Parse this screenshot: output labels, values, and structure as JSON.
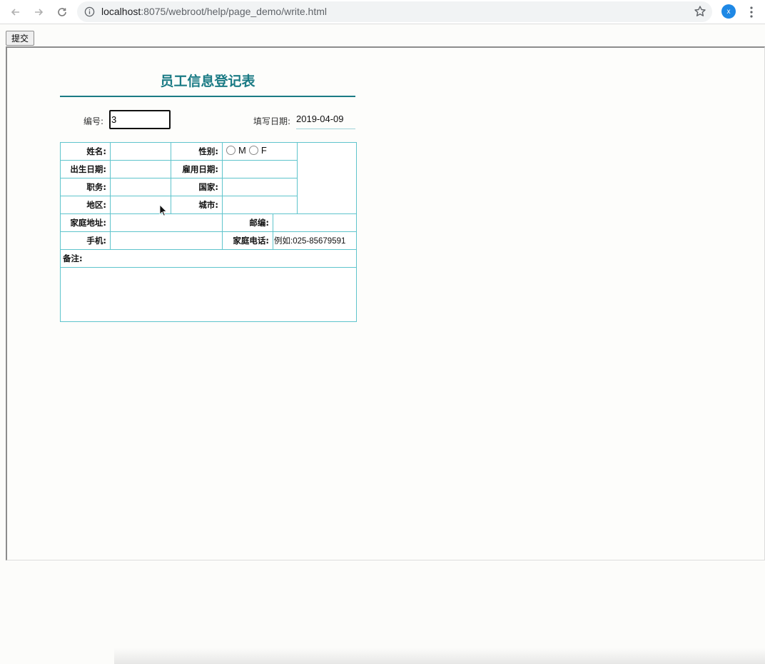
{
  "browser": {
    "url_host": "localhost",
    "url_rest": ":8075/webroot/help/page_demo/write.html",
    "profile_initial": "x"
  },
  "page": {
    "submit_label": "提交",
    "title": "员工信息登记表",
    "id_label": "编号:",
    "id_value": "3",
    "fill_date_label": "填写日期:",
    "fill_date_value": "2019-04-09"
  },
  "form": {
    "name_label": "姓名:",
    "gender_label": "性别:",
    "gender_options": [
      "M",
      "F"
    ],
    "birth_label": "出生日期:",
    "hire_label": "雇用日期:",
    "position_label": "职务:",
    "country_label": "国家:",
    "region_label": "地区:",
    "city_label": "城市:",
    "address_label": "家庭地址:",
    "zip_label": "邮编:",
    "mobile_label": "手机:",
    "home_phone_label": "家庭电话:",
    "home_phone_placeholder": "例如:025-85679591",
    "notes_label": "备注:"
  },
  "colors": {
    "accent": "#1b7b85",
    "table_border": "#5fc4cc"
  }
}
